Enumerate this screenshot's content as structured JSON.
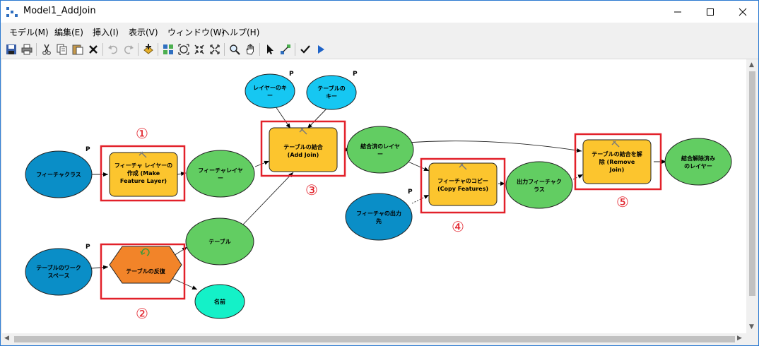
{
  "window": {
    "title": "Model1_AddJoin"
  },
  "menu": [
    "モデル(M)",
    "編集(E)",
    "挿入(I)",
    "表示(V)",
    "ウィンドウ(W)",
    "ヘルプ(H)"
  ],
  "nodes": {
    "feature_class": [
      "フィーチャクラス"
    ],
    "make_feature_layer": [
      "フィーチャ レイヤーの",
      "作成 (Make",
      "Feature Layer)"
    ],
    "feature_layer": [
      "フィーチャレイヤ",
      "ー"
    ],
    "table_workspace": [
      "テーブルのワーク",
      "スペース"
    ],
    "iterate_tables": [
      "テーブルの反復"
    ],
    "table": [
      "テーブル"
    ],
    "name": [
      "名前"
    ],
    "layer_key": [
      "レイヤーのキ",
      "ー"
    ],
    "table_key": [
      "テーブルの",
      "キー"
    ],
    "add_join": [
      "テーブルの結合",
      "(Add Join)"
    ],
    "joined_layer": [
      "結合済のレイヤ",
      "ー"
    ],
    "feature_output": [
      "フィーチャの出力",
      "先"
    ],
    "copy_features": [
      "フィーチャのコピー",
      "(Copy Features)"
    ],
    "output_feature_class": [
      "出力フィーチャク",
      "ラス"
    ],
    "remove_join": [
      "テーブルの結合を解",
      "除 (Remove",
      "Join)"
    ],
    "unjoined_layer": [
      "結合解除済み",
      "のレイヤー"
    ]
  },
  "param_marker": "P",
  "callouts": [
    "①",
    "②",
    "③",
    "④",
    "⑤"
  ],
  "colors": {
    "input_blue": "#0a8ec7",
    "param_cyan": "#16c7f2",
    "tool_yellow": "#fcc52e",
    "iterator_orange": "#f28429",
    "output_green": "#62cd62",
    "name_teal": "#14f1c8",
    "highlight_red": "#e2212a"
  }
}
